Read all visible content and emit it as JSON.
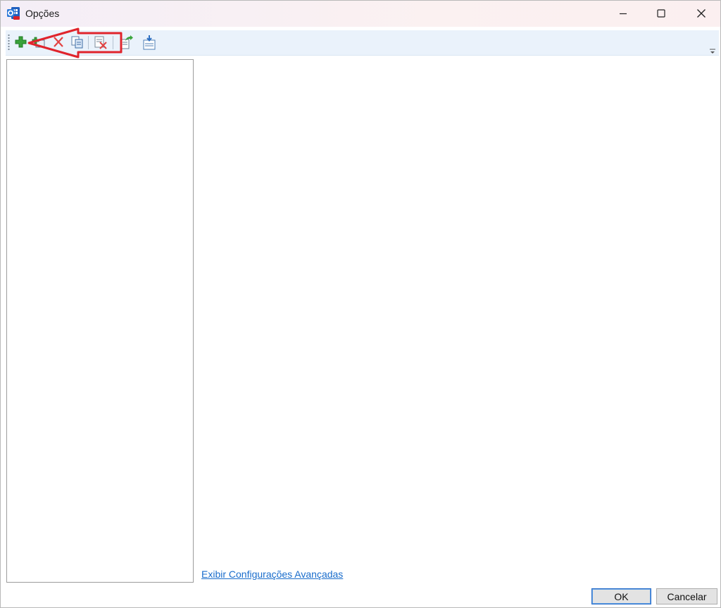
{
  "window": {
    "title": "Opções",
    "controls": {
      "minimize": "minimize-icon",
      "maximize": "maximize-icon",
      "close": "close-icon"
    }
  },
  "toolbar": {
    "buttons": [
      {
        "name": "add-icon"
      },
      {
        "name": "add-subitem-icon"
      },
      {
        "name": "delete-icon"
      },
      {
        "name": "copy-icon"
      },
      {
        "name": "delete-document-icon"
      },
      {
        "name": "export-icon"
      },
      {
        "name": "import-icon"
      }
    ],
    "overflow": "overflow-chevron-icon"
  },
  "annotation": {
    "color": "#e0242c"
  },
  "content": {
    "advanced_link": "Exibir Configurações Avançadas"
  },
  "footer": {
    "ok_label": "OK",
    "cancel_label": "Cancelar"
  }
}
